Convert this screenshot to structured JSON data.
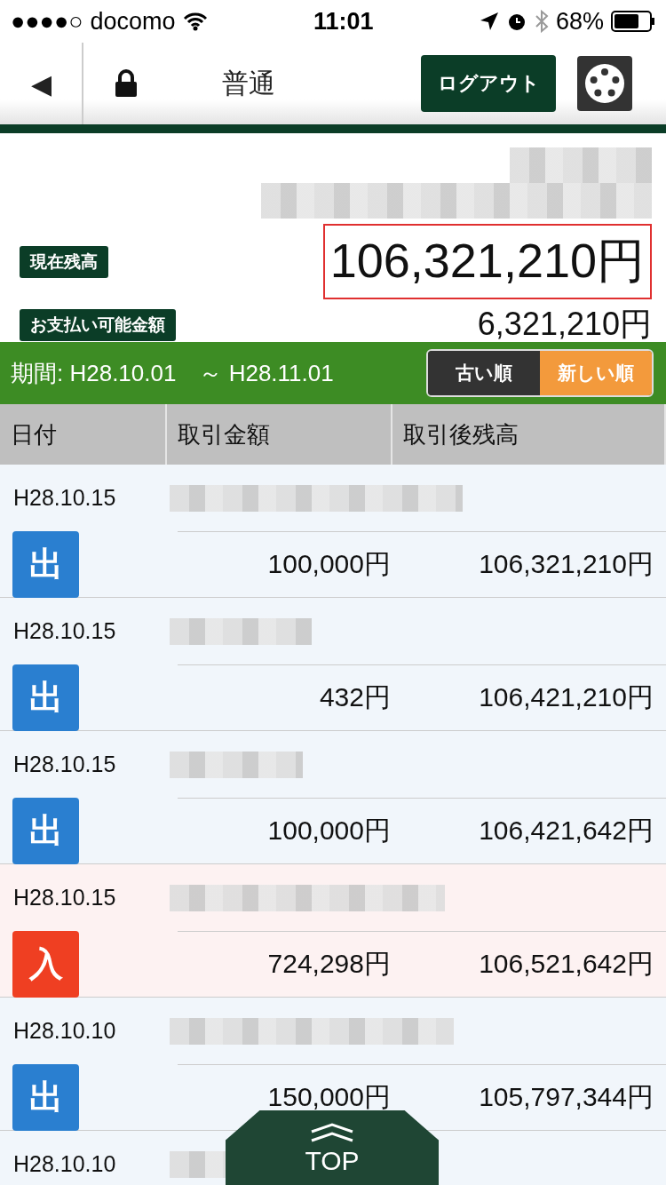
{
  "status_bar": {
    "signal": "●●●●○",
    "carrier": "docomo",
    "time": "11:01",
    "battery": "68%"
  },
  "header": {
    "back": "◀",
    "title": "普通",
    "logout": "ログアウト"
  },
  "account": {
    "balance_label": "現在残高",
    "balance": "106,321,210円",
    "available_label": "お支払い可能金額",
    "available": "6,321,210円"
  },
  "period": {
    "label": "期間: H28.10.01　～ H28.11.01",
    "sort": [
      {
        "label": "古い順",
        "selected": false
      },
      {
        "label": "新しい順",
        "selected": true
      }
    ]
  },
  "table": {
    "columns": [
      "日付",
      "取引金額",
      "取引後残高"
    ],
    "rows": [
      {
        "date": "H28.10.15",
        "kind": "withdrawal",
        "badge": "出",
        "amount": "100,000円",
        "balance": "106,321,210円"
      },
      {
        "date": "H28.10.15",
        "kind": "withdrawal",
        "badge": "出",
        "amount": "432円",
        "balance": "106,421,210円"
      },
      {
        "date": "H28.10.15",
        "kind": "withdrawal",
        "badge": "出",
        "amount": "100,000円",
        "balance": "106,421,642円"
      },
      {
        "date": "H28.10.15",
        "kind": "deposit",
        "badge": "入",
        "amount": "724,298円",
        "balance": "106,521,642円"
      },
      {
        "date": "H28.10.10",
        "kind": "withdrawal",
        "badge": "出",
        "amount": "150,000円",
        "balance": "105,797,344円"
      },
      {
        "date": "H28.10.10",
        "kind": "withdrawal"
      }
    ]
  },
  "top_button": "TOP"
}
